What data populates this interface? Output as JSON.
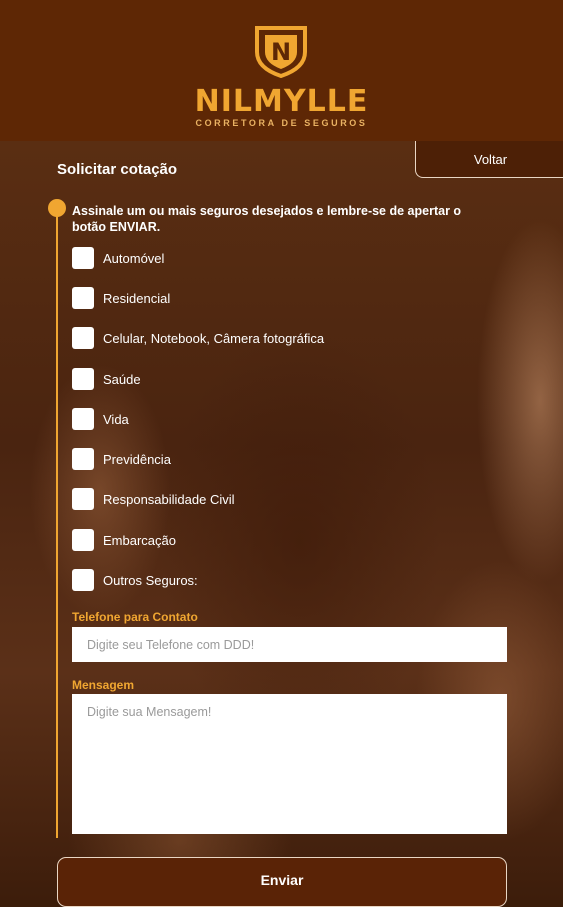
{
  "brand": {
    "logo_letter": "N",
    "name": "NILMYLLE",
    "subtitle": "CORRETORA DE SEGUROS"
  },
  "page": {
    "title": "Solicitar cotação",
    "back_label": "Voltar",
    "instructions": "Assinale um ou mais seguros desejados e lembre-se de apertar o botão ENVIAR."
  },
  "options": [
    {
      "label": "Automóvel",
      "checked": false
    },
    {
      "label": "Residencial",
      "checked": false
    },
    {
      "label": "Celular, Notebook, Câmera fotográfica",
      "checked": false
    },
    {
      "label": "Saúde",
      "checked": false
    },
    {
      "label": "Vida",
      "checked": false
    },
    {
      "label": "Previdência",
      "checked": false
    },
    {
      "label": "Responsabilidade Civil",
      "checked": false
    },
    {
      "label": "Embarcação",
      "checked": false
    },
    {
      "label": "Outros Seguros:",
      "checked": false
    }
  ],
  "phone": {
    "label": "Telefone para Contato",
    "value": "",
    "placeholder": "Digite seu Telefone com DDD!"
  },
  "message": {
    "label": "Mensagem",
    "value": "",
    "placeholder": "Digite sua Mensagem!"
  },
  "submit_label": "Enviar",
  "colors": {
    "header": "#5e2705",
    "accent": "#f0a631"
  },
  "icons": {
    "logo": "shield-n-icon",
    "timeline_dot": "circle-dot-icon"
  }
}
